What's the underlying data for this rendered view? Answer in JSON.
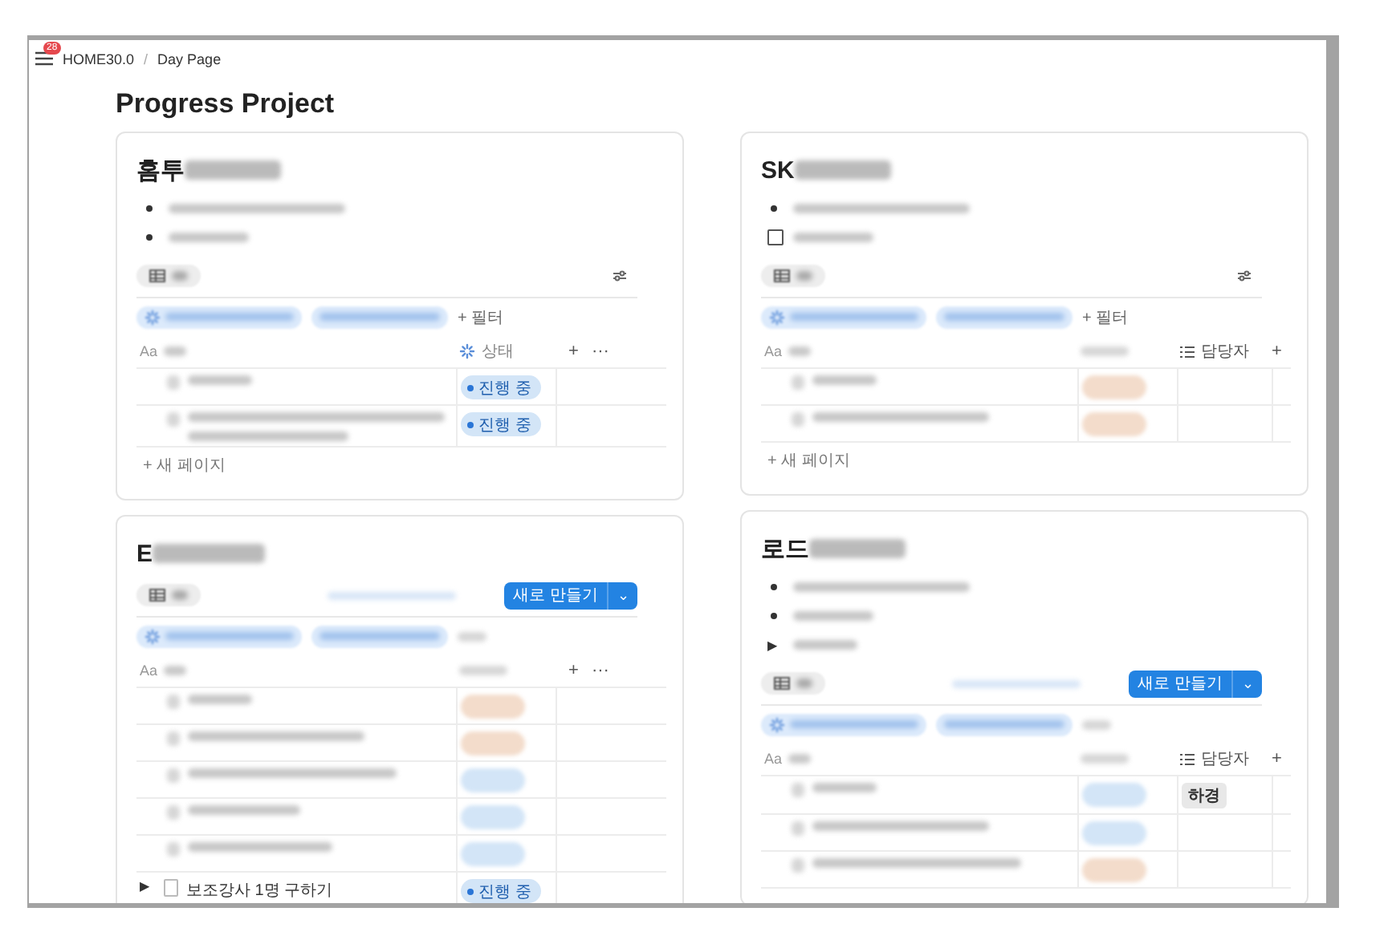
{
  "topbar": {
    "badge": "28",
    "breadcrumbs": [
      "HOME30.0",
      "Day Page"
    ],
    "separator": "/"
  },
  "page_title": "Progress Project",
  "cards": [
    {
      "title": "홈투",
      "blocks": [
        {
          "kind": "bullet"
        },
        {
          "kind": "bullet"
        }
      ],
      "filter_button": "+ 필터",
      "columns": [
        {
          "kind": "title",
          "icon": "Aa"
        },
        {
          "kind": "status",
          "label": "상태"
        },
        {
          "kind": "add",
          "label": "+"
        },
        {
          "kind": "more",
          "label": "···"
        }
      ],
      "rows": [
        {
          "color": "#d3e5f7",
          "status": "진행 중",
          "wrapped": false
        },
        {
          "color": "#d3e5f7",
          "status": "진행 중",
          "wrapped": true
        }
      ],
      "new_page": "+ 새 페이지"
    },
    {
      "title": "SK",
      "blocks": [
        {
          "kind": "bullet"
        },
        {
          "kind": "checkbox",
          "checked": false
        }
      ],
      "filter_button": "+ 필터",
      "columns": [
        {
          "kind": "title",
          "icon": "Aa"
        },
        {
          "kind": "status"
        },
        {
          "kind": "person",
          "label": "담당자"
        },
        {
          "kind": "add",
          "label": "+"
        }
      ],
      "rows": [
        {
          "color": "#f3dccb",
          "wrapped": false
        },
        {
          "color": "#f3dccb",
          "wrapped": false
        }
      ],
      "new_page": "+ 새 페이지"
    },
    {
      "title": "E",
      "new_button": {
        "label": "새로 만들기",
        "caret": "⌄"
      },
      "columns": [
        {
          "kind": "title",
          "icon": "Aa"
        },
        {
          "kind": "status"
        },
        {
          "kind": "add",
          "label": "+"
        },
        {
          "kind": "more",
          "label": "···"
        }
      ],
      "rows": [
        {
          "color": "#f3dccb",
          "wrapped": false
        },
        {
          "color": "#f3dccb",
          "wrapped": false
        },
        {
          "color": "#d3e5f7",
          "wrapped": false
        },
        {
          "color": "#d3e5f7",
          "wrapped": false
        },
        {
          "color": "#d3e5f7",
          "wrapped": false
        },
        {
          "color": "#d3e5f7",
          "status": "진행 중",
          "title": "보조강사 1명 구하기",
          "toggle": "▶"
        }
      ]
    },
    {
      "title": "로드",
      "blocks": [
        {
          "kind": "bullet"
        },
        {
          "kind": "bullet"
        },
        {
          "kind": "toggle",
          "label": "▶"
        }
      ],
      "new_button": {
        "label": "새로 만들기",
        "caret": "⌄"
      },
      "columns": [
        {
          "kind": "title",
          "icon": "Aa"
        },
        {
          "kind": "status"
        },
        {
          "kind": "person",
          "label": "담당자"
        },
        {
          "kind": "add",
          "label": "+"
        }
      ],
      "rows": [
        {
          "color": "#d3e5f7",
          "person": "하경",
          "wrapped": false
        },
        {
          "color": "#d3e5f7",
          "wrapped": false
        },
        {
          "color": "#f3dccb",
          "wrapped": false
        }
      ]
    }
  ]
}
